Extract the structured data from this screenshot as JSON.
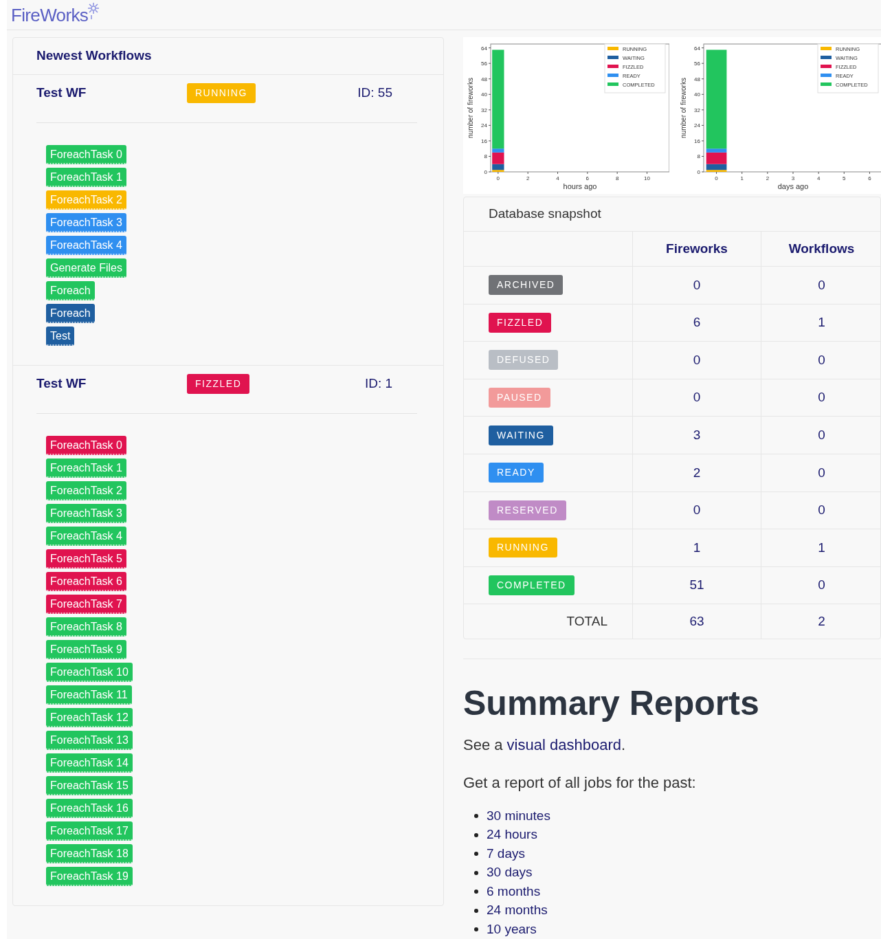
{
  "logo": {
    "text": "FireWorks"
  },
  "workflows_panel": {
    "title": "Newest Workflows",
    "workflows": [
      {
        "name": "Test WF",
        "state": "RUNNING",
        "id": "ID: 55",
        "tasks": [
          {
            "name": "ForeachTask 0",
            "color": "#22c55e"
          },
          {
            "name": "ForeachTask 1",
            "color": "#22c55e"
          },
          {
            "name": "ForeachTask 2",
            "color": "#f9b800"
          },
          {
            "name": "ForeachTask 3",
            "color": "#2f8ff0"
          },
          {
            "name": "ForeachTask 4",
            "color": "#2f8ff0"
          },
          {
            "name": "Generate Files",
            "color": "#22c55e"
          },
          {
            "name": "Foreach",
            "color": "#22c55e"
          },
          {
            "name": "Foreach",
            "color": "#1f5fa0"
          },
          {
            "name": "Test",
            "color": "#1f5fa0"
          }
        ]
      },
      {
        "name": "Test WF",
        "state": "FIZZLED",
        "id": "ID: 1",
        "tasks": [
          {
            "name": "ForeachTask 0",
            "color": "#e0134f"
          },
          {
            "name": "ForeachTask 1",
            "color": "#22c55e"
          },
          {
            "name": "ForeachTask 2",
            "color": "#22c55e"
          },
          {
            "name": "ForeachTask 3",
            "color": "#22c55e"
          },
          {
            "name": "ForeachTask 4",
            "color": "#22c55e"
          },
          {
            "name": "ForeachTask 5",
            "color": "#e0134f"
          },
          {
            "name": "ForeachTask 6",
            "color": "#e0134f"
          },
          {
            "name": "ForeachTask 7",
            "color": "#e0134f"
          },
          {
            "name": "ForeachTask 8",
            "color": "#22c55e"
          },
          {
            "name": "ForeachTask 9",
            "color": "#22c55e"
          },
          {
            "name": "ForeachTask 10",
            "color": "#22c55e"
          },
          {
            "name": "ForeachTask 11",
            "color": "#22c55e"
          },
          {
            "name": "ForeachTask 12",
            "color": "#22c55e"
          },
          {
            "name": "ForeachTask 13",
            "color": "#22c55e"
          },
          {
            "name": "ForeachTask 14",
            "color": "#22c55e"
          },
          {
            "name": "ForeachTask 15",
            "color": "#22c55e"
          },
          {
            "name": "ForeachTask 16",
            "color": "#22c55e"
          },
          {
            "name": "ForeachTask 17",
            "color": "#22c55e"
          },
          {
            "name": "ForeachTask 18",
            "color": "#22c55e"
          },
          {
            "name": "ForeachTask 19",
            "color": "#22c55e"
          }
        ]
      }
    ]
  },
  "charts": [
    {
      "chart_data": {
        "type": "bar",
        "stacked": true,
        "xlabel": "hours ago",
        "ylabel": "number of fireworks",
        "x": [
          0
        ],
        "xlim": [
          -0.5,
          11.5
        ],
        "xticks": [
          0,
          2,
          4,
          6,
          8,
          10
        ],
        "legend": "upper right",
        "yticks": [
          0,
          8,
          16,
          24,
          32,
          40,
          48,
          56,
          64
        ],
        "ylim": [
          0,
          66
        ],
        "series": [
          {
            "name": "RUNNING",
            "color": "#f9b800",
            "values": [
              1
            ]
          },
          {
            "name": "WAITING",
            "color": "#1f5fa0",
            "values": [
              3
            ]
          },
          {
            "name": "FIZZLED",
            "color": "#e0134f",
            "values": [
              6
            ]
          },
          {
            "name": "READY",
            "color": "#2f8ff0",
            "values": [
              2
            ]
          },
          {
            "name": "COMPLETED",
            "color": "#22c55e",
            "values": [
              51
            ]
          }
        ]
      }
    },
    {
      "chart_data": {
        "type": "bar",
        "stacked": true,
        "xlabel": "days ago",
        "ylabel": "number of fireworks",
        "x": [
          0
        ],
        "xlim": [
          -0.5,
          6.5
        ],
        "xticks": [
          0,
          1,
          2,
          3,
          4,
          5,
          6
        ],
        "legend": "upper right",
        "yticks": [
          0,
          8,
          16,
          24,
          32,
          40,
          48,
          56,
          64
        ],
        "ylim": [
          0,
          66
        ],
        "series": [
          {
            "name": "RUNNING",
            "color": "#f9b800",
            "values": [
              1
            ]
          },
          {
            "name": "WAITING",
            "color": "#1f5fa0",
            "values": [
              3
            ]
          },
          {
            "name": "FIZZLED",
            "color": "#e0134f",
            "values": [
              6
            ]
          },
          {
            "name": "READY",
            "color": "#2f8ff0",
            "values": [
              2
            ]
          },
          {
            "name": "COMPLETED",
            "color": "#22c55e",
            "values": [
              51
            ]
          }
        ]
      }
    }
  ],
  "snapshot": {
    "title": "Database snapshot",
    "columns": [
      "Fireworks",
      "Workflows"
    ],
    "rows": [
      {
        "state": "ARCHIVED",
        "fireworks": "0",
        "workflows": "0"
      },
      {
        "state": "FIZZLED",
        "fireworks": "6",
        "workflows": "1"
      },
      {
        "state": "DEFUSED",
        "fireworks": "0",
        "workflows": "0"
      },
      {
        "state": "PAUSED",
        "fireworks": "0",
        "workflows": "0"
      },
      {
        "state": "WAITING",
        "fireworks": "3",
        "workflows": "0"
      },
      {
        "state": "READY",
        "fireworks": "2",
        "workflows": "0"
      },
      {
        "state": "RESERVED",
        "fireworks": "0",
        "workflows": "0"
      },
      {
        "state": "RUNNING",
        "fireworks": "1",
        "workflows": "1"
      },
      {
        "state": "COMPLETED",
        "fireworks": "51",
        "workflows": "0"
      }
    ],
    "total": {
      "label": "TOTAL",
      "fireworks": "63",
      "workflows": "2"
    }
  },
  "reports": {
    "title": "Summary Reports",
    "dashboard_text": "See a ",
    "dashboard_link": "visual dashboard",
    "dashboard_end": ".",
    "intro": "Get a report of all jobs for the past:",
    "links": [
      "30 minutes",
      "24 hours",
      "7 days",
      "30 days",
      "6 months",
      "24 months",
      "10 years"
    ]
  }
}
